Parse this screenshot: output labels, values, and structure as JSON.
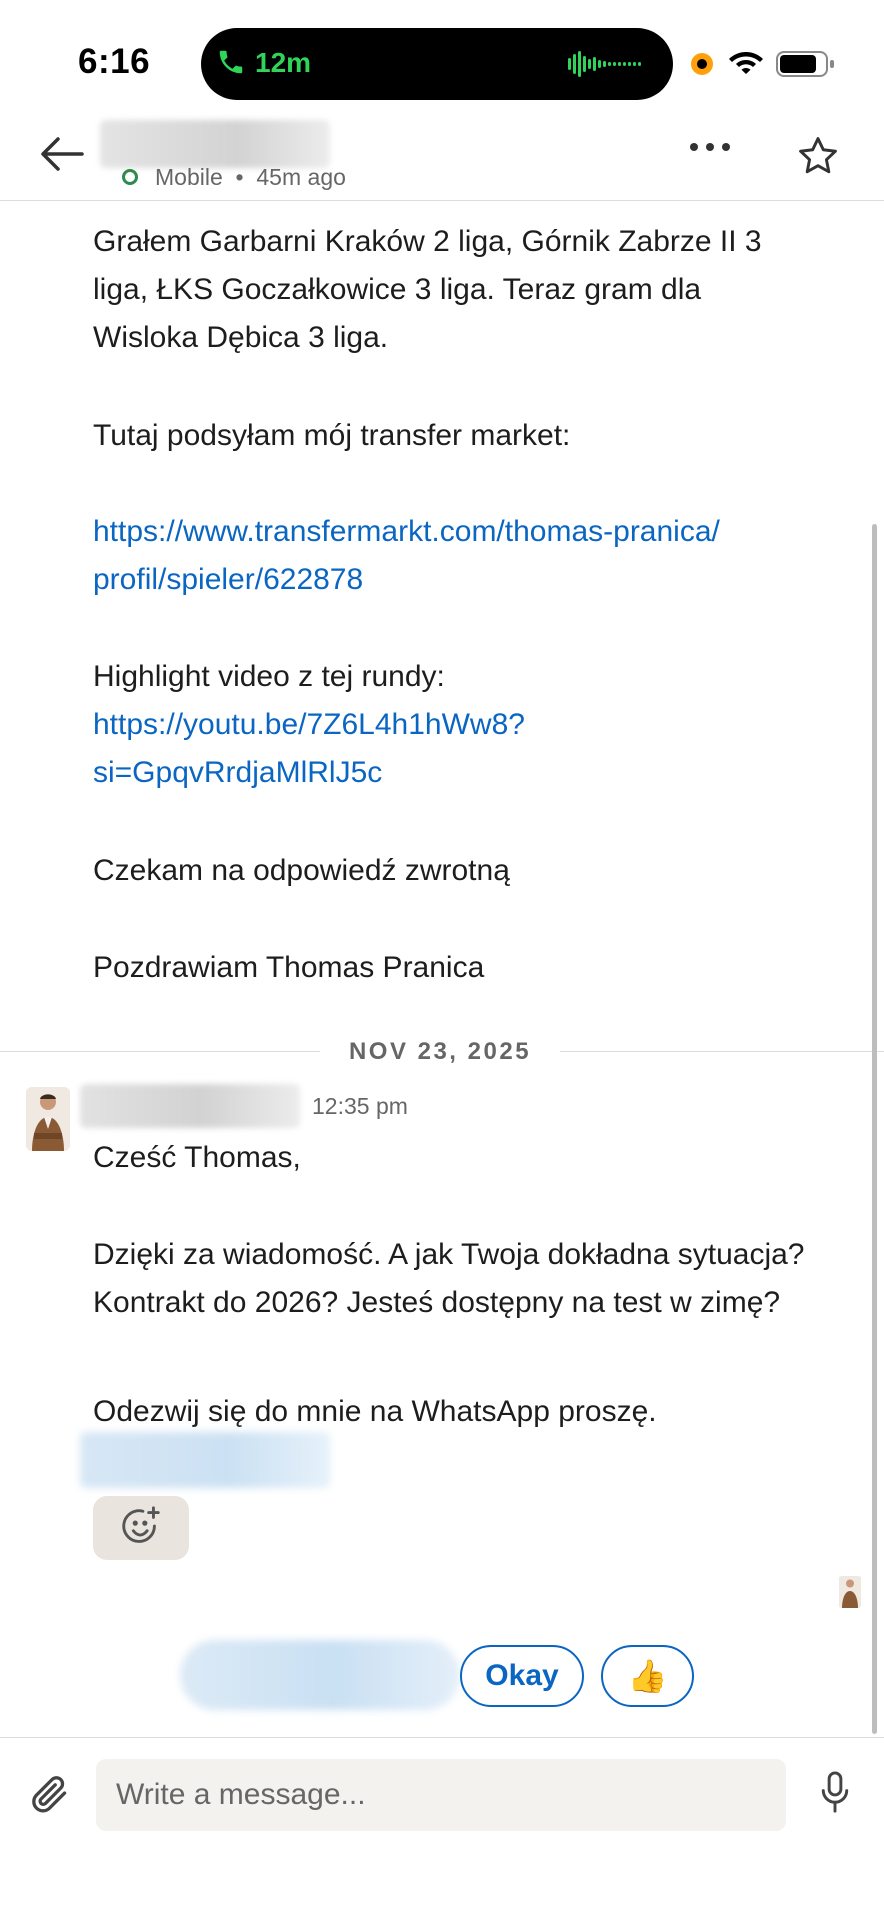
{
  "status_bar": {
    "time": "6:16",
    "call_duration": "12m",
    "call_color": "#2fd458",
    "recording_indicator_color": "#ff9f0a"
  },
  "header": {
    "back_icon": "arrow-left-icon",
    "presence": "Mobile",
    "separator": "•",
    "last_active": "45m ago",
    "more_icon": "more-horizontal-icon",
    "star_icon": "star-outline-icon"
  },
  "conversation": {
    "message1": {
      "para1": "Grałem Garbarni Kraków 2 liga, Górnik Zabrze II 3 liga, ŁKS Goczałkowice 3 liga. Teraz gram dla Wisloka Dębica 3 liga.",
      "para2": "Tutaj podsyłam mój transfer market:",
      "link1_line1": "https://www.transfermarkt.com/thomas-pranica/",
      "link1_line2": "profil/spieler/622878",
      "para3": "Highlight video z tej rundy:",
      "link2_line1": "https://youtu.be/7Z6L4h1hWw8?",
      "link2_line2": "si=GpqvRrdjaMlRlJ5c",
      "para4": "Czekam na odpowiedź zwrotną",
      "para5": "Pozdrawiam Thomas Pranica"
    },
    "date_divider": "NOV 23, 2025",
    "message2": {
      "time": "12:35 pm",
      "greeting": "Cześć Thomas,",
      "body": "Dzięki za wiadomość. A jak Twoja dokładna sytuacja? Kontrakt do 2026? Jesteś dostępny na test w zimę?",
      "request": "Odezwij się do mnie na WhatsApp proszę."
    },
    "reaction_icon": "add-reaction-icon"
  },
  "quick_replies": {
    "okay": "Okay",
    "thumbs": "👍"
  },
  "composer": {
    "placeholder": "Write a message...",
    "attach_icon": "paperclip-icon",
    "mic_icon": "microphone-icon"
  },
  "colors": {
    "link": "#0a66c2",
    "presence": "#2f8a4d"
  }
}
